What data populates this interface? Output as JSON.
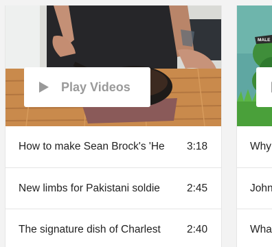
{
  "carousel": {
    "cards": [
      {
        "play_label": "Play Videos",
        "videos": [
          {
            "title": "How to make Sean Brock's 'He",
            "duration": "3:18"
          },
          {
            "title": "New limbs for Pakistani soldie",
            "duration": "2:45"
          },
          {
            "title": "The signature dish of Charlest",
            "duration": "2:40"
          }
        ]
      },
      {
        "thumb_badge": "MALE",
        "videos": [
          {
            "title": "Why"
          },
          {
            "title": "John"
          },
          {
            "title": "Wha"
          }
        ]
      }
    ]
  },
  "colors": {
    "play_overlay_bg": "#ffffff",
    "play_text": "#9a9a9a",
    "title_text": "#222222"
  },
  "icons": {
    "play": "play-triangle-icon"
  }
}
